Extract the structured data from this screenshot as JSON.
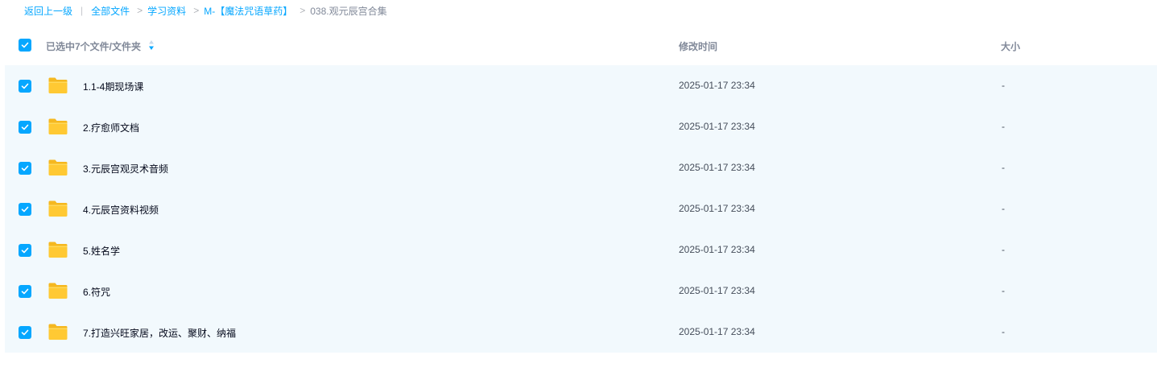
{
  "breadcrumb": {
    "back": "返回上一级",
    "divider": "|",
    "separator": ">",
    "items": [
      "全部文件",
      "学习资料",
      "M-【魔法咒语草药】"
    ],
    "current": "038.观元辰宫合集"
  },
  "header": {
    "selection_text": "已选中7个文件/文件夹",
    "col_modified": "修改时间",
    "col_size": "大小"
  },
  "rows": [
    {
      "name": "1.1-4期现场课",
      "modified": "2025-01-17 23:34",
      "size": "-",
      "checked": true
    },
    {
      "name": "2.疗愈师文档",
      "modified": "2025-01-17 23:34",
      "size": "-",
      "checked": true
    },
    {
      "name": "3.元辰宫观灵术音频",
      "modified": "2025-01-17 23:34",
      "size": "-",
      "checked": true
    },
    {
      "name": "4.元辰宫资料视频",
      "modified": "2025-01-17 23:34",
      "size": "-",
      "checked": true
    },
    {
      "name": "5.姓名学",
      "modified": "2025-01-17 23:34",
      "size": "-",
      "checked": true
    },
    {
      "name": "6.符咒",
      "modified": "2025-01-17 23:34",
      "size": "-",
      "checked": true
    },
    {
      "name": "7.打造兴旺家居，改运、聚财、纳福",
      "modified": "2025-01-17 23:34",
      "size": "-",
      "checked": true
    }
  ],
  "colors": {
    "accent": "#06a7ff",
    "list_bg": "#f2f9fd",
    "folder": "#ffc933"
  },
  "icons": {
    "checkbox": "checkbox-checked-icon",
    "folder": "folder-icon",
    "sort": "sort-icon"
  }
}
